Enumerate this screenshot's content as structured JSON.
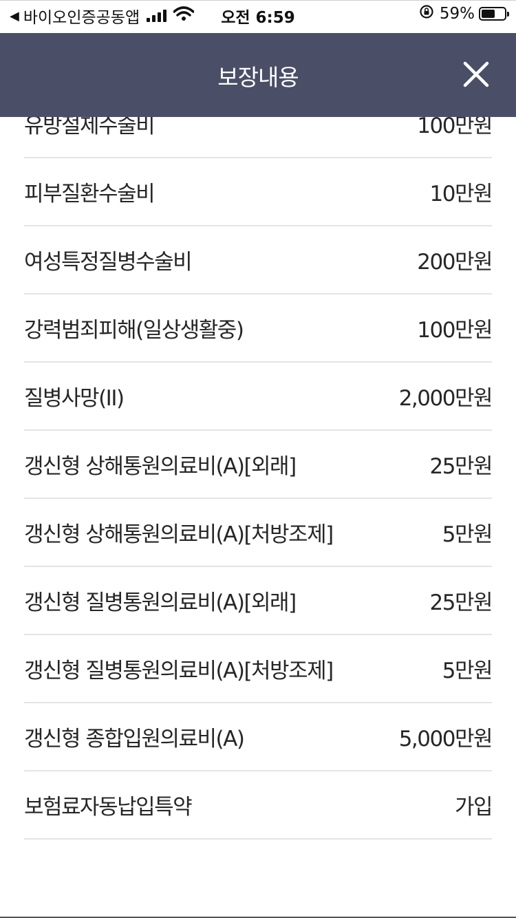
{
  "status_bar": {
    "back_app": "바이오인증공동앱",
    "time": "오전 6:59",
    "battery": "59%",
    "battery_level": 0.59
  },
  "header": {
    "title": "보장내용"
  },
  "coverage_items": [
    {
      "label": "유방절제수술비",
      "value": "100만원"
    },
    {
      "label": "피부질환수술비",
      "value": "10만원"
    },
    {
      "label": "여성특정질병수술비",
      "value": "200만원"
    },
    {
      "label": "강력범죄피해(일상생활중)",
      "value": "100만원"
    },
    {
      "label": "질병사망(II)",
      "value": "2,000만원"
    },
    {
      "label": "갱신형 상해통원의료비(A)[외래]",
      "value": "25만원"
    },
    {
      "label": "갱신형 상해통원의료비(A)[처방조제]",
      "value": "5만원"
    },
    {
      "label": "갱신형 질병통원의료비(A)[외래]",
      "value": "25만원"
    },
    {
      "label": "갱신형 질병통원의료비(A)[처방조제]",
      "value": "5만원"
    },
    {
      "label": "갱신형 종합입원의료비(A)",
      "value": "5,000만원"
    },
    {
      "label": "보험료자동납입특약",
      "value": "가입"
    }
  ],
  "icons": {
    "back": "back-arrow-icon",
    "signal": "signal-icon",
    "wifi": "wifi-icon",
    "rotation_lock": "rotation-lock-icon",
    "battery": "battery-icon",
    "close": "close-icon"
  },
  "colors": {
    "header_bg": "#4a4f67",
    "header_text": "#ffffff",
    "divider": "#e4e4e4",
    "text": "#262626"
  }
}
